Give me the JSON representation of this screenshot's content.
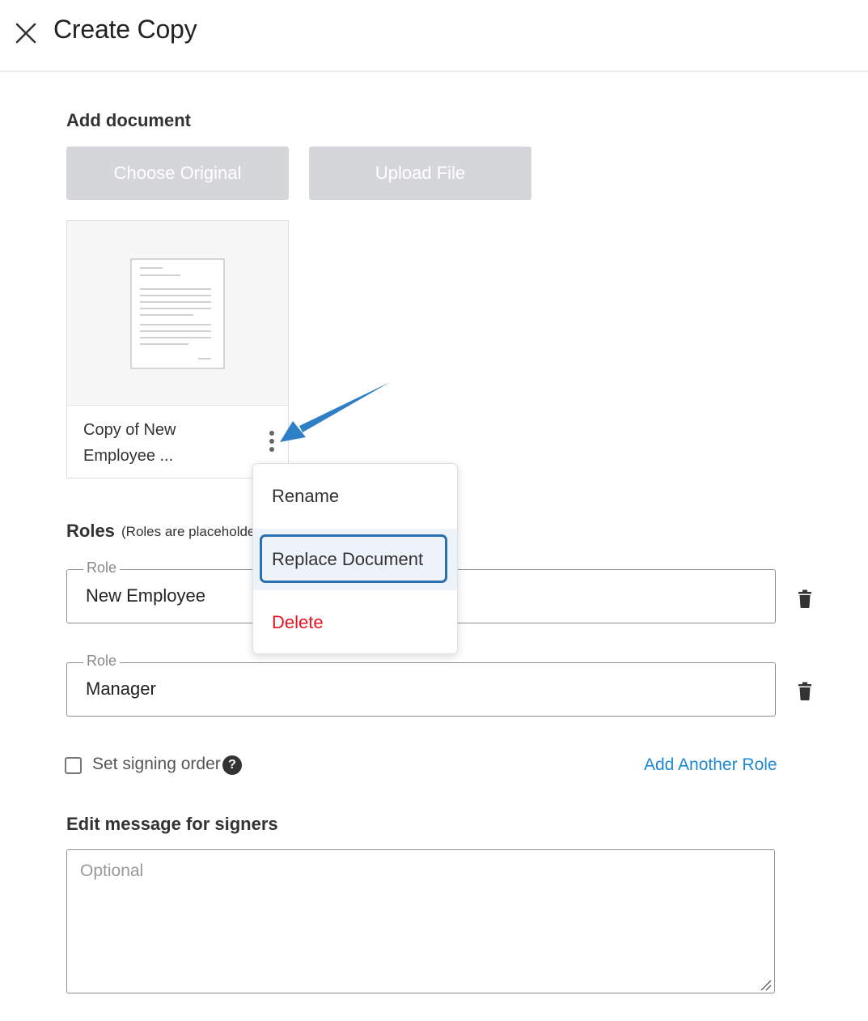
{
  "header": {
    "title": "Create Copy",
    "close_icon": "close-icon"
  },
  "add_document": {
    "title": "Add document",
    "choose_original_label": "Choose Original",
    "upload_file_label": "Upload File"
  },
  "document_card": {
    "name_line1": "Copy of New",
    "name_line2": "Employee ...",
    "thumbnail_icon": "document-thumbnail-icon",
    "menu_icon": "kebab-menu-icon"
  },
  "context_menu": {
    "items": [
      {
        "label": "Rename"
      },
      {
        "label": "Replace Document",
        "highlighted": true
      },
      {
        "label": "Delete",
        "color": "#e8141f"
      }
    ]
  },
  "roles": {
    "title": "Roles",
    "note": "(Roles are placeholde",
    "fields": [
      {
        "legend": "Role",
        "value": "New Employee"
      },
      {
        "legend": "Role",
        "value": "Manager"
      }
    ],
    "delete_icon": "trash-icon"
  },
  "signing_order": {
    "label": "Set signing order",
    "checked": false,
    "help_icon": "question-circle-icon"
  },
  "add_role_link": "Add Another Role",
  "message": {
    "title": "Edit message for signers",
    "placeholder": "Optional",
    "value": ""
  },
  "colors": {
    "accent_link": "#1e88d2",
    "danger": "#e8141f",
    "focus_ring": "#2a6fb0",
    "disabled_button": "#d5d6d9",
    "annotation_arrow": "#2f7fc6"
  }
}
